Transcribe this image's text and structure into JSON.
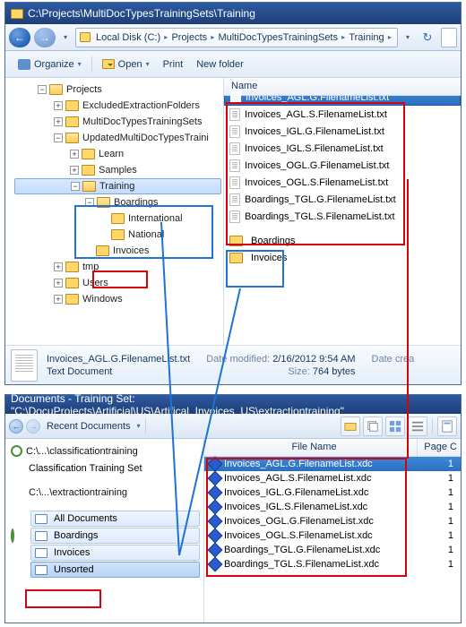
{
  "explorer": {
    "title": "C:\\Projects\\MultiDocTypesTrainingSets\\Training",
    "breadcrumbs": [
      "Local Disk (C:)",
      "Projects",
      "MultiDocTypesTrainingSets",
      "Training"
    ],
    "cmd": {
      "organize": "Organize",
      "open": "Open",
      "print": "Print",
      "newfolder": "New folder"
    },
    "name_col": "Name",
    "tree": {
      "projects": "Projects",
      "excluded": "ExcludedExtractionFolders",
      "multi": "MultiDocTypesTrainingSets",
      "updated": "UpdatedMultiDocTypesTraini",
      "learn": "Learn",
      "samples": "Samples",
      "training": "Training",
      "boardings": "Boardings",
      "international": "International",
      "national": "National",
      "invoices": "Invoices",
      "tmp": "tmp",
      "users": "Users",
      "windows": "Windows"
    },
    "files": [
      "Invoices_AGL.G.FilenameList.txt",
      "Invoices_AGL.S.FilenameList.txt",
      "Invoices_IGL.G.FilenameList.txt",
      "Invoices_IGL.S.FilenameList.txt",
      "Invoices_OGL.G.FilenameList.txt",
      "Invoices_OGL.S.FilenameList.txt",
      "Boardings_TGL.G.FilenameList.txt",
      "Boardings_TGL.S.FilenameList.txt"
    ],
    "sub_folders": [
      "Boardings",
      "Invoices"
    ],
    "detail": {
      "name": "Invoices_AGL.G.FilenameList.txt",
      "type": "Text Document",
      "modified_label": "Date modified:",
      "modified": "2/16/2012 9:54 AM",
      "size_label": "Size:",
      "size": "764 bytes",
      "created_label": "Date crea"
    }
  },
  "app": {
    "title": "Documents - Training Set: \"C:\\DocuProjects\\Artificial\\US\\Artifical_Invoices_US\\extractiontraining\"",
    "recent": "Recent Documents",
    "paths": {
      "classification": "C:\\...\\classificationtraining",
      "class_label": "Classification Training Set",
      "extraction": "C:\\...\\extractiontraining"
    },
    "folders": {
      "all": "All Documents",
      "boardings": "Boardings",
      "invoices": "Invoices",
      "unsorted": "Unsorted"
    },
    "cols": {
      "name": "File Name",
      "page": "Page C"
    },
    "rows": [
      {
        "name": "Invoices_AGL.G.FilenameList.xdc",
        "page": "1"
      },
      {
        "name": "Invoices_AGL.S.FilenameList.xdc",
        "page": "1"
      },
      {
        "name": "Invoices_IGL.G.FilenameList.xdc",
        "page": "1"
      },
      {
        "name": "Invoices_IGL.S.FilenameList.xdc",
        "page": "1"
      },
      {
        "name": "Invoices_OGL.G.FilenameList.xdc",
        "page": "1"
      },
      {
        "name": "Invoices_OGL.S.FilenameList.xdc",
        "page": "1"
      },
      {
        "name": "Boardings_TGL.G.FilenameList.xdc",
        "page": "1"
      },
      {
        "name": "Boardings_TGL.S.FilenameList.xdc",
        "page": "1"
      }
    ]
  }
}
